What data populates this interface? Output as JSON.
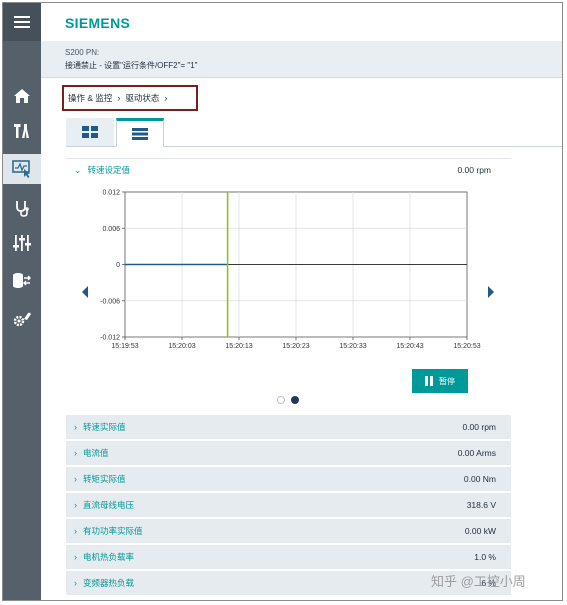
{
  "header": {
    "logo": "SIEMENS"
  },
  "status": {
    "device": "S200 PN:",
    "message": "接通禁止 - 设置\"运行条件/OFF2\"= \"1\""
  },
  "breadcrumb": {
    "items": [
      "操作 & 监控",
      "驱动状态"
    ],
    "separator": "›"
  },
  "sidebar": {
    "items": [
      {
        "name": "menu-icon",
        "active": false
      },
      {
        "name": "home-icon",
        "active": false
      },
      {
        "name": "tools-icon",
        "active": false
      },
      {
        "name": "monitor-icon",
        "active": true
      },
      {
        "name": "diagnostics-icon",
        "active": false
      },
      {
        "name": "sliders-icon",
        "active": false
      },
      {
        "name": "database-transfer-icon",
        "active": false
      },
      {
        "name": "settings-wrench-icon",
        "active": false
      }
    ]
  },
  "view_tabs": [
    {
      "name": "grid-view-icon",
      "active": false
    },
    {
      "name": "list-view-icon",
      "active": true
    }
  ],
  "chart_panel": {
    "title": "转速设定值",
    "value": "0.00 rpm",
    "pause_label": "暂停"
  },
  "chart_data": {
    "type": "line",
    "x_ticks": [
      "15:19:53",
      "15:20:03",
      "15:20:13",
      "15:20:23",
      "15:20:33",
      "15:20:43",
      "15:20:53"
    ],
    "y_ticks": [
      "0.012",
      "0.006",
      "0",
      "-0.006",
      "-0.012"
    ],
    "ylim": [
      -0.012,
      0.012
    ],
    "grid": true,
    "series": [
      {
        "x": [
          "15:19:53",
          "15:20:11"
        ],
        "y": [
          0,
          0
        ],
        "color": "#1f5a8a"
      }
    ],
    "cursor_x": "15:20:11",
    "cursor_color": "#8fc31f",
    "colors": {
      "axis": "#555555",
      "grid": "#d9dee3",
      "zero_line": "#3a3a3a"
    }
  },
  "pager": {
    "pages": 2,
    "current": 2
  },
  "parameters": [
    {
      "label": "转速实际值",
      "value": "0.00 rpm"
    },
    {
      "label": "电流值",
      "value": "0.00 Arms"
    },
    {
      "label": "转矩实际值",
      "value": "0.00 Nm"
    },
    {
      "label": "直流母线电压",
      "value": "318.6 V"
    },
    {
      "label": "有功功率实际值",
      "value": "0.00 kW"
    },
    {
      "label": "电机热负载率",
      "value": "1.0 %"
    },
    {
      "label": "变频器热负载",
      "value": "6 %"
    }
  ],
  "colors": {
    "accent": "#009999",
    "sidebar": "#55606b",
    "status_bg": "#e9eef2",
    "row_bg": "#e6ebef",
    "highlight_border": "#7a1f1f"
  },
  "watermark": "知乎 @工控小周"
}
